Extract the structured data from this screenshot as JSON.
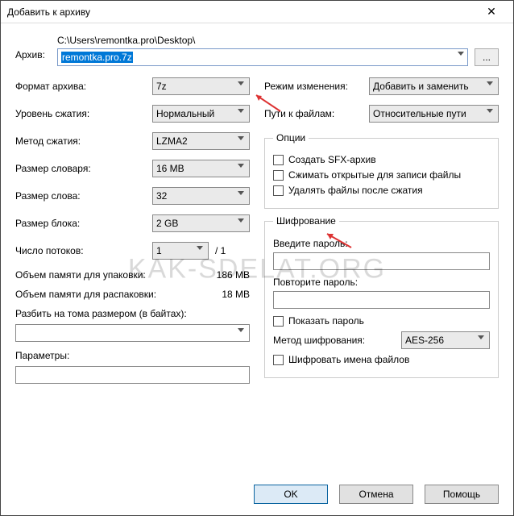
{
  "title": "Добавить к архиву",
  "archive_label": "Архив:",
  "path": "C:\\Users\\remontka.pro\\Desktop\\",
  "archive_value": "remontka.pro.7z",
  "browse": "...",
  "left": {
    "format_label": "Формат архива:",
    "format_value": "7z",
    "level_label": "Уровень сжатия:",
    "level_value": "Нормальный",
    "method_label": "Метод сжатия:",
    "method_value": "LZMA2",
    "dict_label": "Размер словаря:",
    "dict_value": "16 MB",
    "word_label": "Размер слова:",
    "word_value": "32",
    "block_label": "Размер блока:",
    "block_value": "2 GB",
    "threads_label": "Число потоков:",
    "threads_value": "1",
    "threads_max": "/ 1",
    "mem_pack_label": "Объем памяти для упаковки:",
    "mem_pack_value": "186 MB",
    "mem_unpack_label": "Объем памяти для распаковки:",
    "mem_unpack_value": "18 MB",
    "split_label": "Разбить на тома размером (в байтах):",
    "split_value": "",
    "params_label": "Параметры:",
    "params_value": ""
  },
  "right": {
    "update_label": "Режим изменения:",
    "update_value": "Добавить и заменить",
    "paths_label": "Пути к файлам:",
    "paths_value": "Относительные пути",
    "options_legend": "Опции",
    "opt_sfx": "Создать SFX-архив",
    "opt_open": "Сжимать открытые для записи файлы",
    "opt_delete": "Удалять файлы после сжатия",
    "enc_legend": "Шифрование",
    "enc_pwd_label": "Введите пароль:",
    "enc_pwd2_label": "Повторите пароль:",
    "enc_show": "Показать пароль",
    "enc_method_label": "Метод шифрования:",
    "enc_method_value": "AES-256",
    "enc_names": "Шифровать имена файлов"
  },
  "buttons": {
    "ok": "OK",
    "cancel": "Отмена",
    "help": "Помощь"
  },
  "watermark": "KAK-SDELAT.ORG"
}
